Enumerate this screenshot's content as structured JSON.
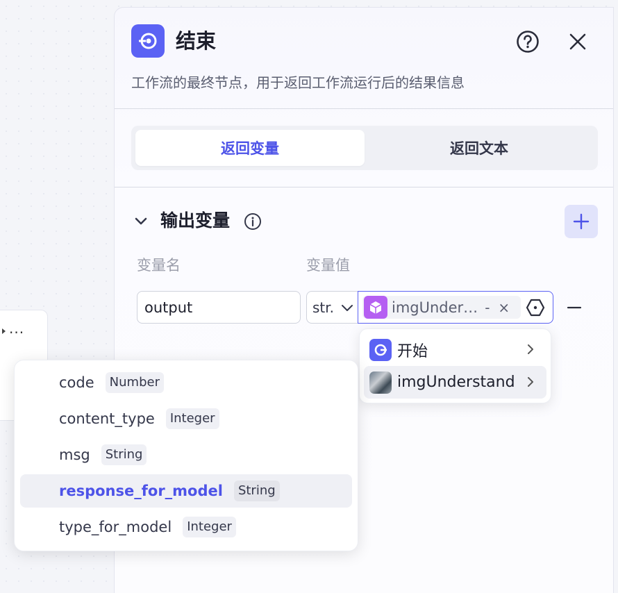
{
  "panel": {
    "title": "结束",
    "subtitle": "工作流的最终节点，用于返回工作流运行后的结果信息",
    "tabs": [
      {
        "label": "返回变量",
        "active": true
      },
      {
        "label": "返回文本",
        "active": false
      }
    ]
  },
  "output_section": {
    "title": "输出变量",
    "columns": {
      "name": "变量名",
      "value": "变量值"
    },
    "row": {
      "name_value": "output",
      "type_label": "str.",
      "ref_label": "imgUnder…",
      "ref_dash": "-",
      "ref_remove": "×"
    }
  },
  "node_menu": {
    "items": [
      {
        "label": "开始",
        "active": false
      },
      {
        "label": "imgUnderstand",
        "active": true
      }
    ]
  },
  "field_menu": {
    "items": [
      {
        "name": "code",
        "type": "Number",
        "active": false
      },
      {
        "name": "content_type",
        "type": "Integer",
        "active": false
      },
      {
        "name": "msg",
        "type": "String",
        "active": false
      },
      {
        "name": "response_for_model",
        "type": "String",
        "active": true
      },
      {
        "name": "type_for_model",
        "type": "Integer",
        "active": false
      }
    ]
  },
  "background_node": {
    "more_label": "···"
  },
  "colors": {
    "accent": "#4d53e8",
    "node_icon": "#5b62f4",
    "chip_icon": "#b55ff2",
    "add_button_bg": "#e1e3fb"
  },
  "icons": {
    "end_node": "end-node-icon",
    "help": "question-circle-icon",
    "close": "close-icon",
    "collapse": "chevron-down-icon",
    "info": "info-circle-icon",
    "add": "plus-icon",
    "type_dropdown": "chevron-down-icon",
    "variable_ref": "variable-hexagon-icon",
    "remove": "minus-icon",
    "submenu": "chevron-right-icon"
  }
}
